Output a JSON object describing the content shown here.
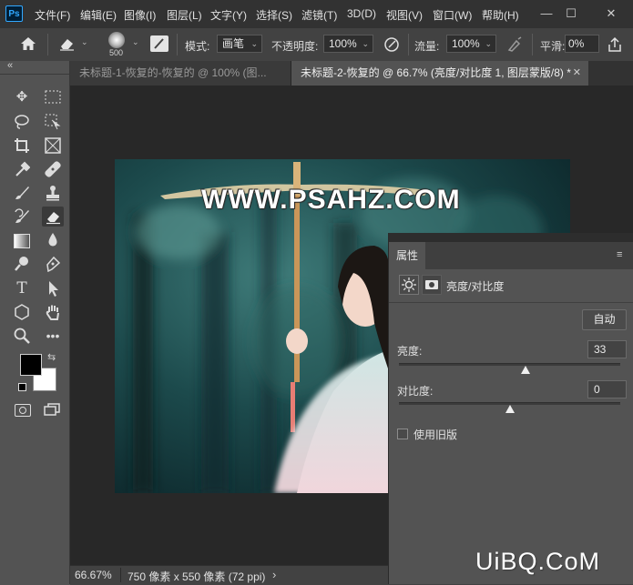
{
  "app": {
    "logo": "Ps"
  },
  "menu": [
    "文件(F)",
    "编辑(E)",
    "图像(I)",
    "图层(L)",
    "文字(Y)",
    "选择(S)",
    "滤镜(T)",
    "3D(D)",
    "视图(V)",
    "窗口(W)",
    "帮助(H)"
  ],
  "window_controls": {
    "minimize": "—",
    "restore": "☐",
    "close": "✕"
  },
  "options": {
    "brush_size": "500",
    "mode_label": "模式:",
    "mode_value": "画笔",
    "opacity_label": "不透明度:",
    "opacity_value": "100%",
    "flow_label": "流量:",
    "flow_value": "100%",
    "smoothing_label": "平滑:",
    "smoothing_value": "0%"
  },
  "tabs": [
    {
      "label": "未标题-1-恢复的-恢复的 @ 100% (图...",
      "active": false
    },
    {
      "label": "未标题-2-恢复的 @ 66.7% (亮度/对比度 1, 图层蒙版/8) *",
      "active": true
    }
  ],
  "collapse_icon": "«",
  "photo_watermark": "WWW.PSAHZ.COM",
  "status": {
    "zoom": "66.67%",
    "doc_info": "750 像素 x 550 像素 (72 ppi)",
    "arrow": "›"
  },
  "properties": {
    "tab_label": "属性",
    "adjustment_title": "亮度/对比度",
    "auto_label": "自动",
    "brightness_label": "亮度:",
    "brightness_value": "33",
    "brightness_fraction": 0.57,
    "contrast_label": "对比度:",
    "contrast_value": "0",
    "contrast_fraction": 0.5,
    "legacy_label": "使用旧版",
    "legacy_checked": false
  },
  "corner_watermark": "UiBQ.CoM",
  "colors": {
    "foreground": "#000000",
    "background": "#ffffff",
    "ps_blue": "#31a8ff"
  }
}
